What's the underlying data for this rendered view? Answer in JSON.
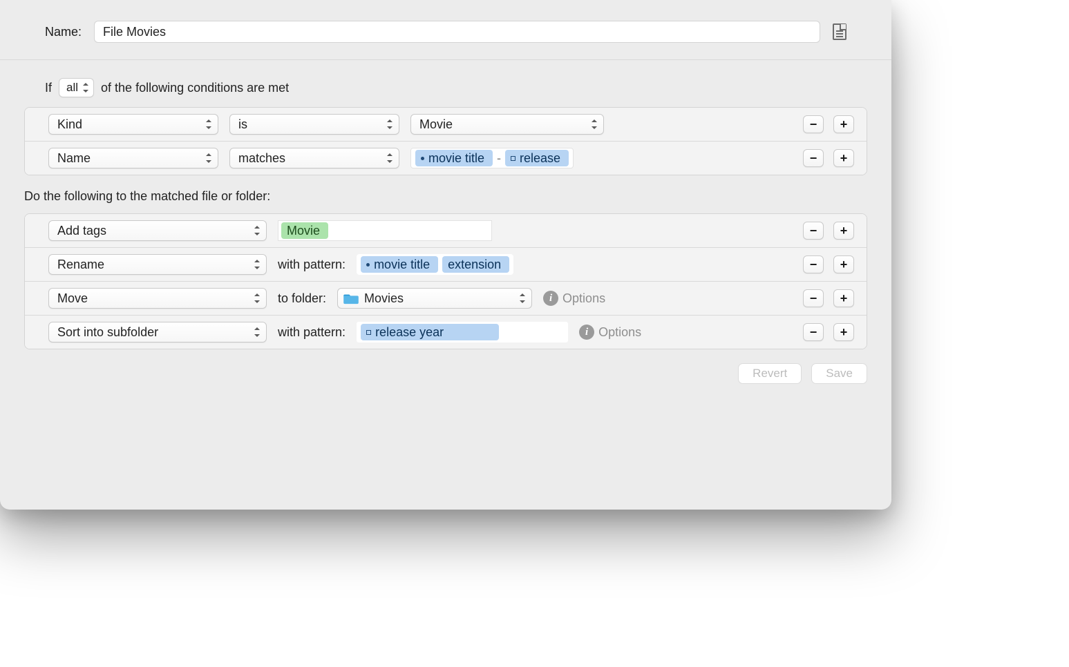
{
  "header": {
    "name_label": "Name:",
    "name_value": "File Movies"
  },
  "if_sentence": {
    "prefix": "If",
    "selector": "all",
    "suffix": "of the following conditions are met"
  },
  "conditions": [
    {
      "attribute": "Kind",
      "operator": "is",
      "value_select": "Movie",
      "tokens": null
    },
    {
      "attribute": "Name",
      "operator": "matches",
      "value_select": null,
      "tokens": [
        {
          "icon": "dot",
          "label": "movie title"
        },
        {
          "sep": "-"
        },
        {
          "icon": "sq",
          "label": "release"
        }
      ]
    }
  ],
  "do_label": "Do the following to the matched file or folder:",
  "actions": {
    "add_tags": {
      "action_label": "Add tags",
      "tag": "Movie"
    },
    "rename": {
      "action_label": "Rename",
      "with_pattern_label": "with pattern:",
      "tokens": [
        {
          "icon": "dot",
          "label": "movie title"
        },
        {
          "icon": "none",
          "label": "extension"
        }
      ]
    },
    "move": {
      "action_label": "Move",
      "to_folder_label": "to folder:",
      "folder_name": "Movies",
      "options_label": "Options"
    },
    "sort": {
      "action_label": "Sort into subfolder",
      "with_pattern_label": "with pattern:",
      "tokens": [
        {
          "icon": "sq",
          "label": "release year"
        }
      ],
      "options_label": "Options"
    }
  },
  "footer": {
    "revert": "Revert",
    "save": "Save"
  },
  "glyphs": {
    "minus": "−",
    "plus": "+"
  }
}
